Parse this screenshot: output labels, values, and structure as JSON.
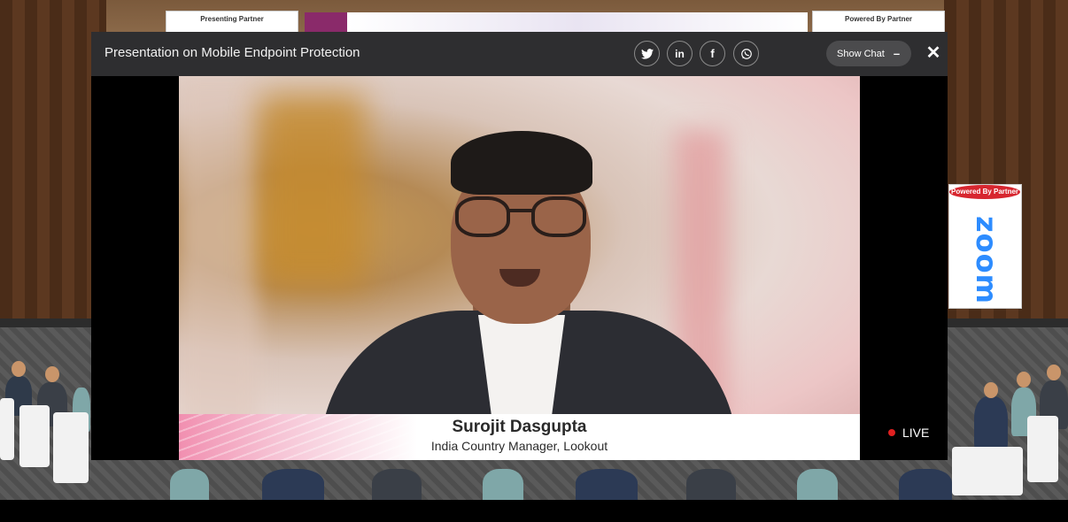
{
  "backdrop": {
    "banner_left_caption": "Presenting Partner",
    "banner_right_caption": "Powered By Partner",
    "side_banner_caption": "Powered By Partner",
    "side_banner_logo": "zoom"
  },
  "modal": {
    "title": "Presentation on Mobile Endpoint Protection",
    "share": {
      "twitter_icon": "twitter-icon",
      "linkedin_label": "in",
      "facebook_label": "f",
      "whatsapp_icon": "whatsapp-icon"
    },
    "show_chat_label": "Show Chat",
    "show_chat_toggle": "–",
    "close_label": "✕"
  },
  "video": {
    "speaker_name": "Surojit Dasgupta",
    "speaker_role": "India Country Manager, Lookout",
    "live_label": "LIVE"
  },
  "colors": {
    "header_bg": "#2e2e30",
    "live_dot": "#e02020",
    "lower_third_accent": "#f18fb0"
  }
}
